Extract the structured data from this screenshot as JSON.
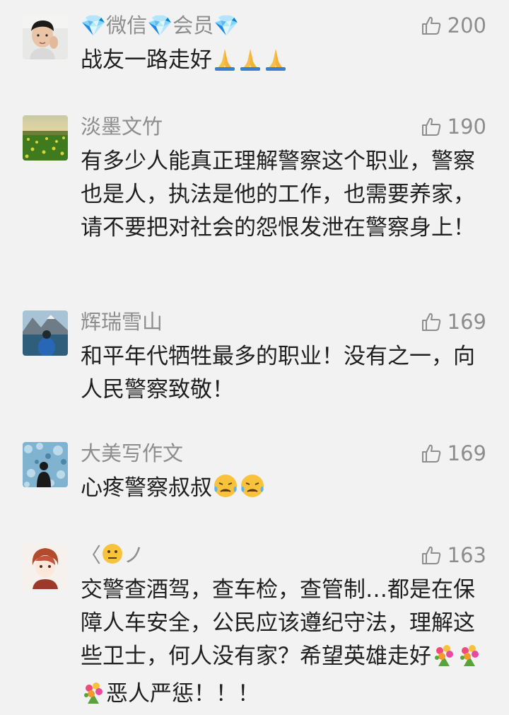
{
  "colors": {
    "background": "#f2f2f2",
    "name": "#8d8d8d",
    "text": "#1f1f1f"
  },
  "comments": [
    {
      "avatar": "boy-portrait",
      "username": "💎微信💎会员💎",
      "likes": "200",
      "text": "战友一路走好",
      "emoji_suffix": [
        "folded-hands-emoji",
        "folded-hands-emoji",
        "folded-hands-emoji"
      ]
    },
    {
      "avatar": "rapeseed-field-landscape",
      "username": "淡墨文竹",
      "likes": "190",
      "text": "有多少人能真正理解警察这个职业，警察也是人，执法是他的工作，也需要养家，请不要把对社会的怨恨发泄在警察身上！"
    },
    {
      "avatar": "mountain-lake-person",
      "username": "辉瑞雪山",
      "likes": "169",
      "text": "和平年代牺牲最多的职业！没有之一，向人民警察致敬！"
    },
    {
      "avatar": "bokeh-silhouette",
      "username": "大美写作文",
      "likes": "169",
      "text": "心疼警察叔叔",
      "emoji_suffix": [
        "crying-face-emoji",
        "crying-face-emoji"
      ]
    },
    {
      "avatar": "anime-boy",
      "username_prefix": "〈",
      "username_emoji": "neutral-face-emoji",
      "username_suffix": "ノ",
      "likes": "163",
      "text_parts": [
        "交警查酒驾，查车检，查管制…都是在保障人车安全，公民应该遵纪守法，理解这些卫士，何人没有家？希望英雄走好",
        "恶人严惩！！！"
      ],
      "emoji_middle": [
        "bouquet-emoji",
        "bouquet-emoji",
        "bouquet-emoji"
      ]
    }
  ]
}
